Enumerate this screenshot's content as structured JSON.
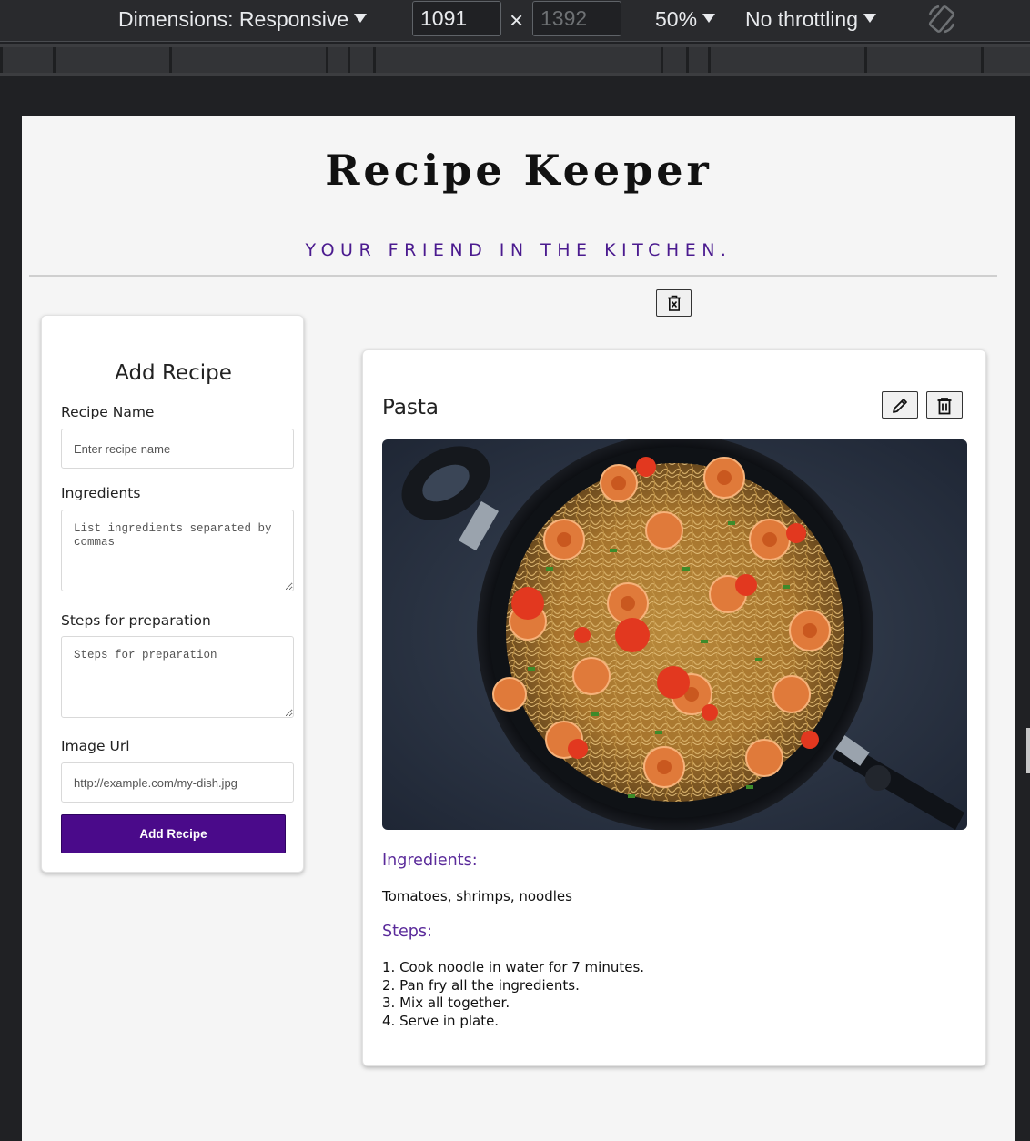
{
  "devtools": {
    "dimensions_label": "Dimensions: Responsive",
    "width_value": "1091",
    "height_value": "1392",
    "times": "×",
    "zoom": "50%",
    "throttling": "No throttling"
  },
  "page": {
    "title": "Recipe Keeper",
    "subtitle": "YOUR FRIEND IN THE KITCHEN."
  },
  "form": {
    "title": "Add Recipe",
    "name_label": "Recipe Name",
    "name_placeholder": "Enter recipe name",
    "ingredients_label": "Ingredients",
    "ingredients_placeholder": "List ingredients separated by commas",
    "steps_label": "Steps for preparation",
    "steps_placeholder": "Steps for preparation",
    "image_label": "Image Url",
    "image_placeholder": "http://example.com/my-dish.jpg",
    "submit_label": "Add Recipe"
  },
  "recipe": {
    "name": "Pasta",
    "ingredients_heading": "Ingredients:",
    "ingredients": "Tomatoes, shrimps, noodles",
    "steps_heading": "Steps:",
    "steps": [
      "1. Cook noodle in water for 7 minutes.",
      "2. Pan fry all the ingredients.",
      "3. Mix all together.",
      "4. Serve in plate."
    ]
  },
  "colors": {
    "accent": "#4a0a8a",
    "subtitle": "#4b1b8f",
    "section_heading": "#5a2a9a"
  }
}
